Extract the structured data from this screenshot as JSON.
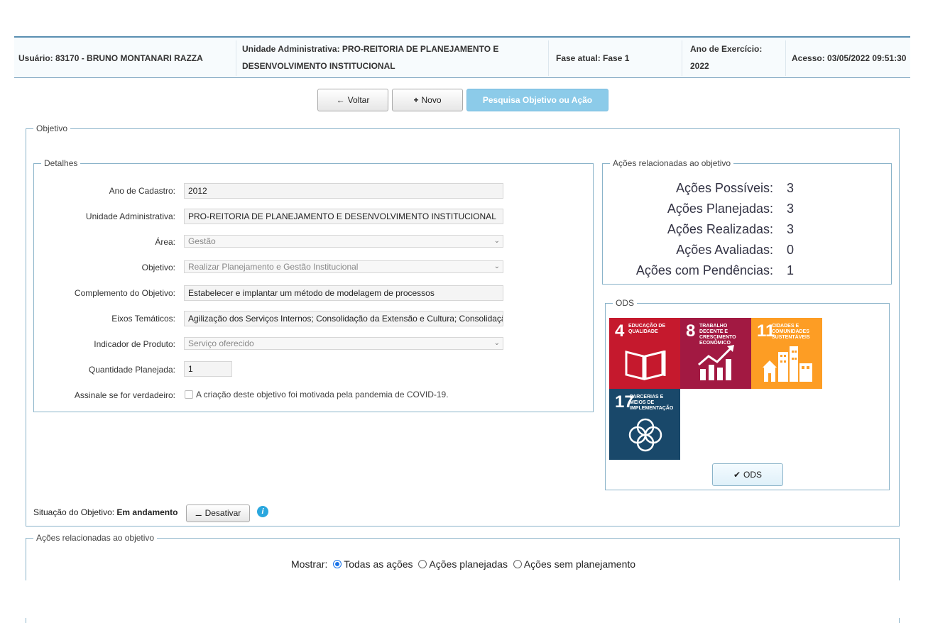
{
  "header": {
    "user": "Usuário: 83170 - BRUNO MONTANARI RAZZA",
    "unit_line1": "Unidade Administrativa: PRO-REITORIA DE PLANEJAMENTO E",
    "unit_line2": "DESENVOLVIMENTO INSTITUCIONAL",
    "phase": "Fase atual: Fase 1",
    "year_label": "Ano de Exercício:",
    "year_value": "2022",
    "access": "Acesso: 03/05/2022 09:51:30"
  },
  "toolbar": {
    "back_label": "Voltar",
    "new_label": "Novo",
    "search_label": "Pesquisa Objetivo ou Ação"
  },
  "objective_legend": "Objetivo",
  "details": {
    "legend": "Detalhes",
    "fields": {
      "ano_label": "Ano de Cadastro:",
      "ano_value": "2012",
      "unidade_label": "Unidade Administrativa:",
      "unidade_value": "PRO-REITORIA DE PLANEJAMENTO E DESENVOLVIMENTO INSTITUCIONAL",
      "area_label": "Área:",
      "area_value": "Gestão",
      "objetivo_label": "Objetivo:",
      "objetivo_value": "Realizar Planejamento e Gestão Institucional",
      "complemento_label": "Complemento do Objetivo:",
      "complemento_value": "Estabelecer e implantar um método de modelagem de processos",
      "eixos_label": "Eixos Temáticos:",
      "eixos_value": "Agilização dos Serviços Internos; Consolidação da Extensão e Cultura; Consolidação",
      "indicador_label": "Indicador de Produto:",
      "indicador_value": "Serviço oferecido",
      "quantidade_label": "Quantidade Planejada:",
      "quantidade_value": "1",
      "assinale_label": "Assinale se for verdadeiro:",
      "covid_label": "A criação deste objetivo foi motivada pela pandemia de COVID-19."
    }
  },
  "actions_summary": {
    "legend": "Ações relacionadas ao objetivo",
    "rows": [
      {
        "label": "Ações Possíveis:",
        "value": "3"
      },
      {
        "label": "Ações Planejadas:",
        "value": "3"
      },
      {
        "label": "Ações Realizadas:",
        "value": "3"
      },
      {
        "label": "Ações Avaliadas:",
        "value": "0"
      },
      {
        "label": "Ações com Pendências:",
        "value": "1"
      }
    ]
  },
  "ods": {
    "legend": "ODS",
    "tiles": [
      {
        "num": "4",
        "text": "EDUCAÇÃO DE QUALIDADE",
        "color": "#c5192d",
        "icon": "book-icon"
      },
      {
        "num": "8",
        "text": "TRABALHO DECENTE E CRESCIMENTO ECONÔMICO",
        "color": "#a21942",
        "icon": "growth-chart-icon"
      },
      {
        "num": "11",
        "text": "CIDADES E COMUNIDADES SUSTENTÁVEIS",
        "color": "#fd9d24",
        "icon": "city-icon"
      },
      {
        "num": "17",
        "text": "PARCERIAS E MEIOS DE IMPLEMENTAÇÃO",
        "color": "#19486a",
        "icon": "flower-rings-icon"
      }
    ],
    "button_label": "ODS"
  },
  "status": {
    "label": "Situação do Objetivo:",
    "value": "Em andamento",
    "deactivate_label": "Desativar"
  },
  "related_actions": {
    "legend": "Ações relacionadas ao objetivo",
    "show_label": "Mostrar:",
    "options": [
      "Todas as ações",
      "Ações planejadas",
      "Ações sem planejamento"
    ],
    "selected": "Todas as ações"
  },
  "colors": {
    "accent": "#5a8fb1",
    "primary_button": "#8ccbe9",
    "info_icon": "#2aa7de"
  }
}
